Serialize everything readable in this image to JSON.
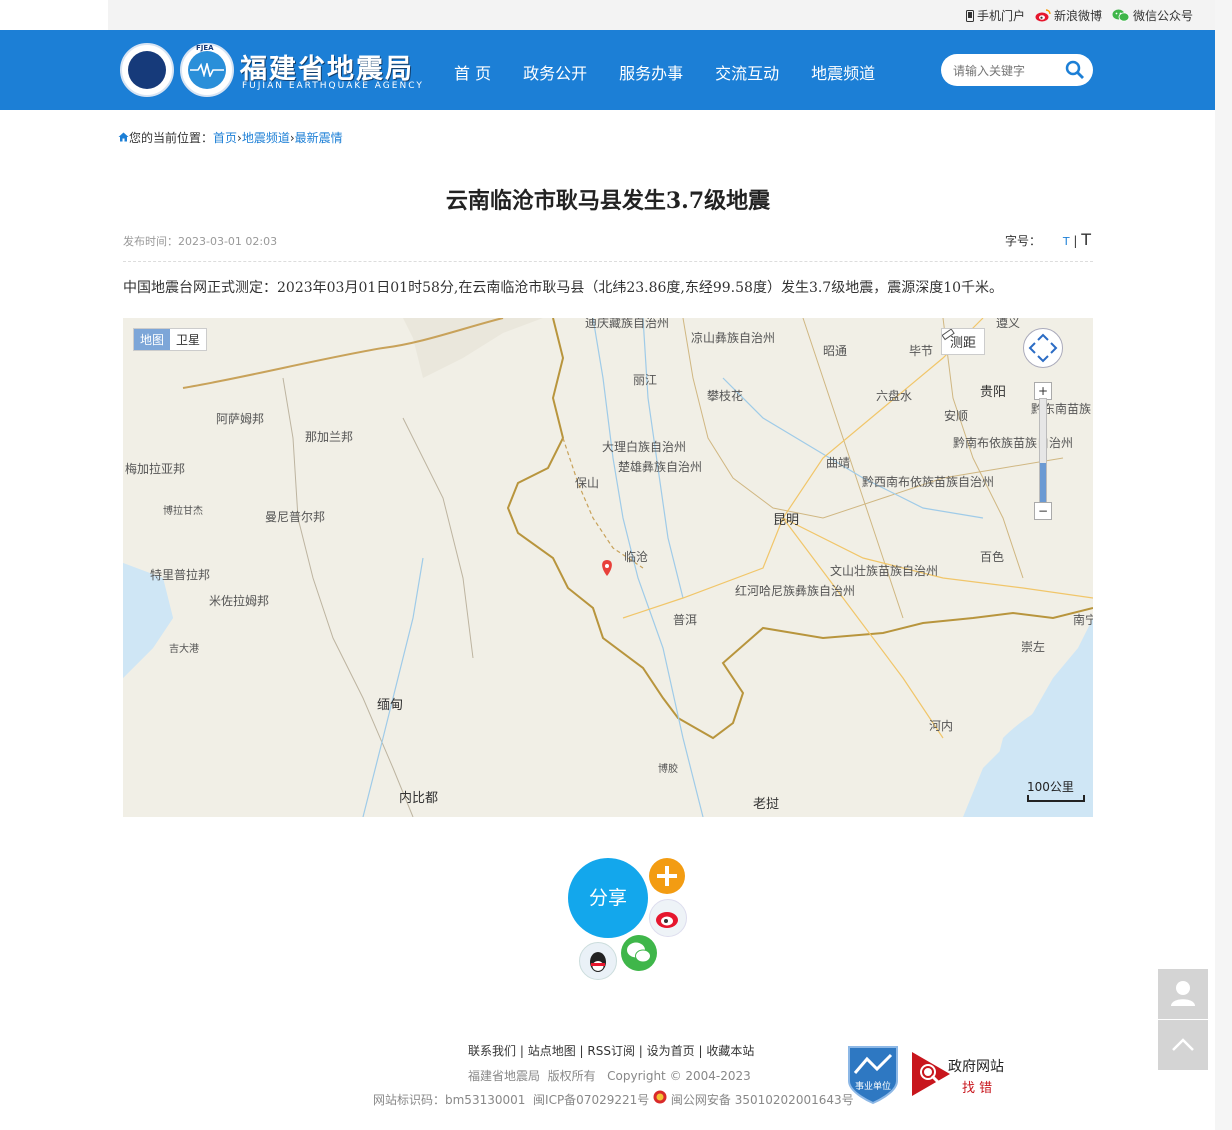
{
  "topbar": {
    "mobile": "手机门户",
    "weibo": "新浪微博",
    "wechat": "微信公众号"
  },
  "header": {
    "brand_cn": "福建省地震局",
    "brand_en": "FUJIAN EARTHQUAKE AGENCY",
    "logo_badge": "FJEA",
    "nav": [
      "首 页",
      "政务公开",
      "服务办事",
      "交流互动",
      "地震频道"
    ],
    "search_placeholder": "请输入关键字"
  },
  "breadcrumb": {
    "prefix": "您的当前位置：",
    "items": [
      "首页",
      "地震频道",
      "最新震情"
    ]
  },
  "article": {
    "title": "云南临沧市耿马县发生3.7级地震",
    "publish_label": "发布时间：",
    "publish_time": "2023-03-01 02:03",
    "fontsize_label": "字号：",
    "fontsize_small": "T",
    "fontsize_large": "T",
    "body": "中国地震台网正式测定：2023年03月01日01时58分,在云南临沧市耿马县（北纬23.86度,东经99.58度）发生3.7级地震，震源深度10千米。"
  },
  "map": {
    "toggle": [
      "地图",
      "卫星"
    ],
    "measure": "测距",
    "zoom_in": "+",
    "zoom_out": "−",
    "scale": "100公里",
    "labels": [
      "迪庆藏族自治州",
      "凉山彝族自治州",
      "昭通",
      "毕节",
      "遵义",
      "丽江",
      "攀枝花",
      "贵阳",
      "六盘水",
      "黔东南苗族",
      "安顺",
      "大理白族自治州",
      "黔南布依族苗族自治州",
      "楚雄彝族自治州",
      "曲靖",
      "黔西南布依族苗族自治州",
      "保山",
      "昆明",
      "阿萨姆邦",
      "那加兰邦",
      "梅加拉亚邦",
      "博拉甘杰",
      "曼尼普尔邦",
      "临沧",
      "百色",
      "特里普拉邦",
      "文山壮族苗族自治州",
      "米佐拉姆邦",
      "红河哈尼族彝族自治州",
      "普洱",
      "南宁",
      "吉大港",
      "崇左",
      "缅甸",
      "河内",
      "博胶",
      "内比都",
      "老挝"
    ]
  },
  "share": {
    "label": "分享"
  },
  "footer": {
    "links": [
      "联系我们",
      "站点地图",
      "RSS订阅",
      "设为首页",
      "收藏本站"
    ],
    "owner": "福建省地震局",
    "rights": "版权所有",
    "copyright": "Copyright © 2004-2023",
    "site_id": "网站标识码：bm53130001",
    "icp": "闽ICP备07029221号",
    "police": "闽公网安备 35010202001643号",
    "badge_unit": "事业单位",
    "badge_gov_line1": "政府网站",
    "badge_gov_line2": "找 错"
  },
  "colors": {
    "header_blue": "#1c7fd6",
    "share_blue": "#13a7ec",
    "marker_red": "#e8403a"
  }
}
